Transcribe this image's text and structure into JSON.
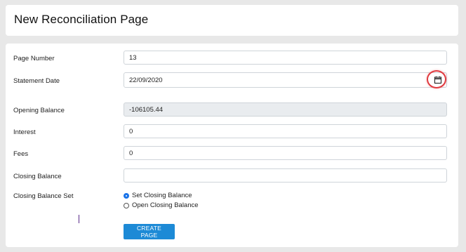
{
  "header": {
    "title": "New Reconciliation Page"
  },
  "form": {
    "page_number": {
      "label": "Page Number",
      "value": "13"
    },
    "statement_date": {
      "label": "Statement Date",
      "value": "22/09/2020",
      "icon": "calendar-icon"
    },
    "opening_balance": {
      "label": "Opening Balance",
      "value": "-106105.44"
    },
    "interest": {
      "label": "Interest",
      "value": "0"
    },
    "fees": {
      "label": "Fees",
      "value": "0"
    },
    "closing_balance": {
      "label": "Closing Balance",
      "value": ""
    },
    "closing_balance_set": {
      "label": "Closing Balance Set",
      "options": [
        {
          "label": "Set Closing Balance",
          "selected": true
        },
        {
          "label": "Open Closing Balance",
          "selected": false
        }
      ]
    },
    "create_button": "CREATE PAGE"
  },
  "colors": {
    "accent": "#1d8ad6",
    "highlight": "#e0393e",
    "readonly_bg": "#e9ecef"
  }
}
